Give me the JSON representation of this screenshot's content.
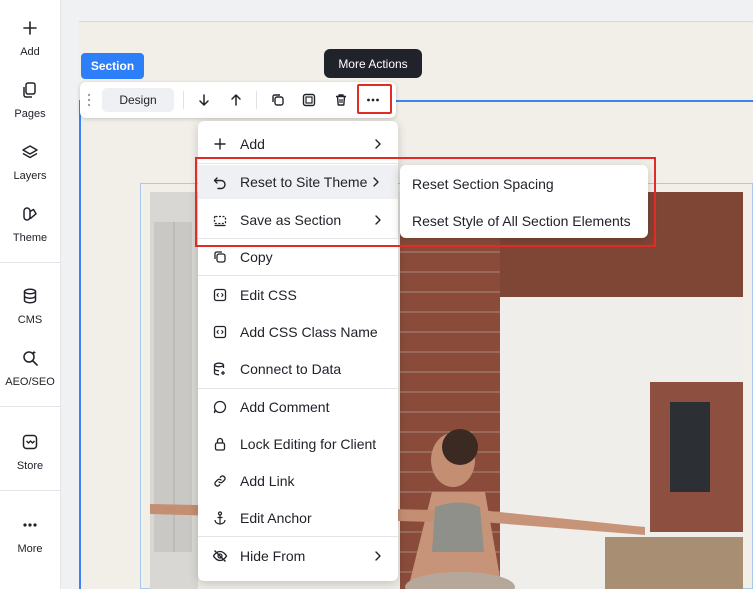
{
  "sidebar": {
    "items": [
      {
        "label": "Add",
        "icon": "plus-icon"
      },
      {
        "label": "Pages",
        "icon": "pages-icon"
      },
      {
        "label": "Layers",
        "icon": "layers-icon"
      },
      {
        "label": "Theme",
        "icon": "theme-icon"
      },
      {
        "label": "CMS",
        "icon": "database-icon"
      },
      {
        "label": "AEO/SEO",
        "icon": "seo-search-icon"
      },
      {
        "label": "Store",
        "icon": "store-icon"
      },
      {
        "label": "More",
        "icon": "more-dots-icon"
      }
    ]
  },
  "section_tag": "Section",
  "tooltip": "More Actions",
  "toolbar": {
    "design_label": "Design",
    "buttons": [
      "move-down-icon",
      "move-up-icon",
      "duplicate-icon",
      "layout-icon",
      "trash-icon",
      "more-dots-icon"
    ]
  },
  "menu": {
    "items": [
      {
        "label": "Add",
        "icon": "plus-icon",
        "submenu": true
      },
      {
        "label": "Reset to Site Theme",
        "icon": "undo-icon",
        "submenu": true
      },
      {
        "label": "Save as Section",
        "icon": "save-section-icon",
        "submenu": true
      },
      {
        "label": "Copy",
        "icon": "copy-icon",
        "submenu": false
      },
      {
        "label": "Edit CSS",
        "icon": "code-icon",
        "submenu": false
      },
      {
        "label": "Add CSS Class Name",
        "icon": "code-icon",
        "submenu": false
      },
      {
        "label": "Connect to Data",
        "icon": "database-link-icon",
        "submenu": false
      },
      {
        "label": "Add Comment",
        "icon": "comment-icon",
        "submenu": false
      },
      {
        "label": "Lock Editing for Client",
        "icon": "lock-icon",
        "submenu": false
      },
      {
        "label": "Add Link",
        "icon": "link-icon",
        "submenu": false
      },
      {
        "label": "Edit Anchor",
        "icon": "anchor-icon",
        "submenu": false
      },
      {
        "label": "Hide From",
        "icon": "eye-off-icon",
        "submenu": true
      }
    ]
  },
  "submenu": {
    "items": [
      "Reset Section Spacing",
      "Reset Style of All Section Elements"
    ]
  },
  "colors": {
    "accent": "#2d7ff9",
    "highlight": "#e02b27",
    "tooltip_bg": "#20232a"
  }
}
